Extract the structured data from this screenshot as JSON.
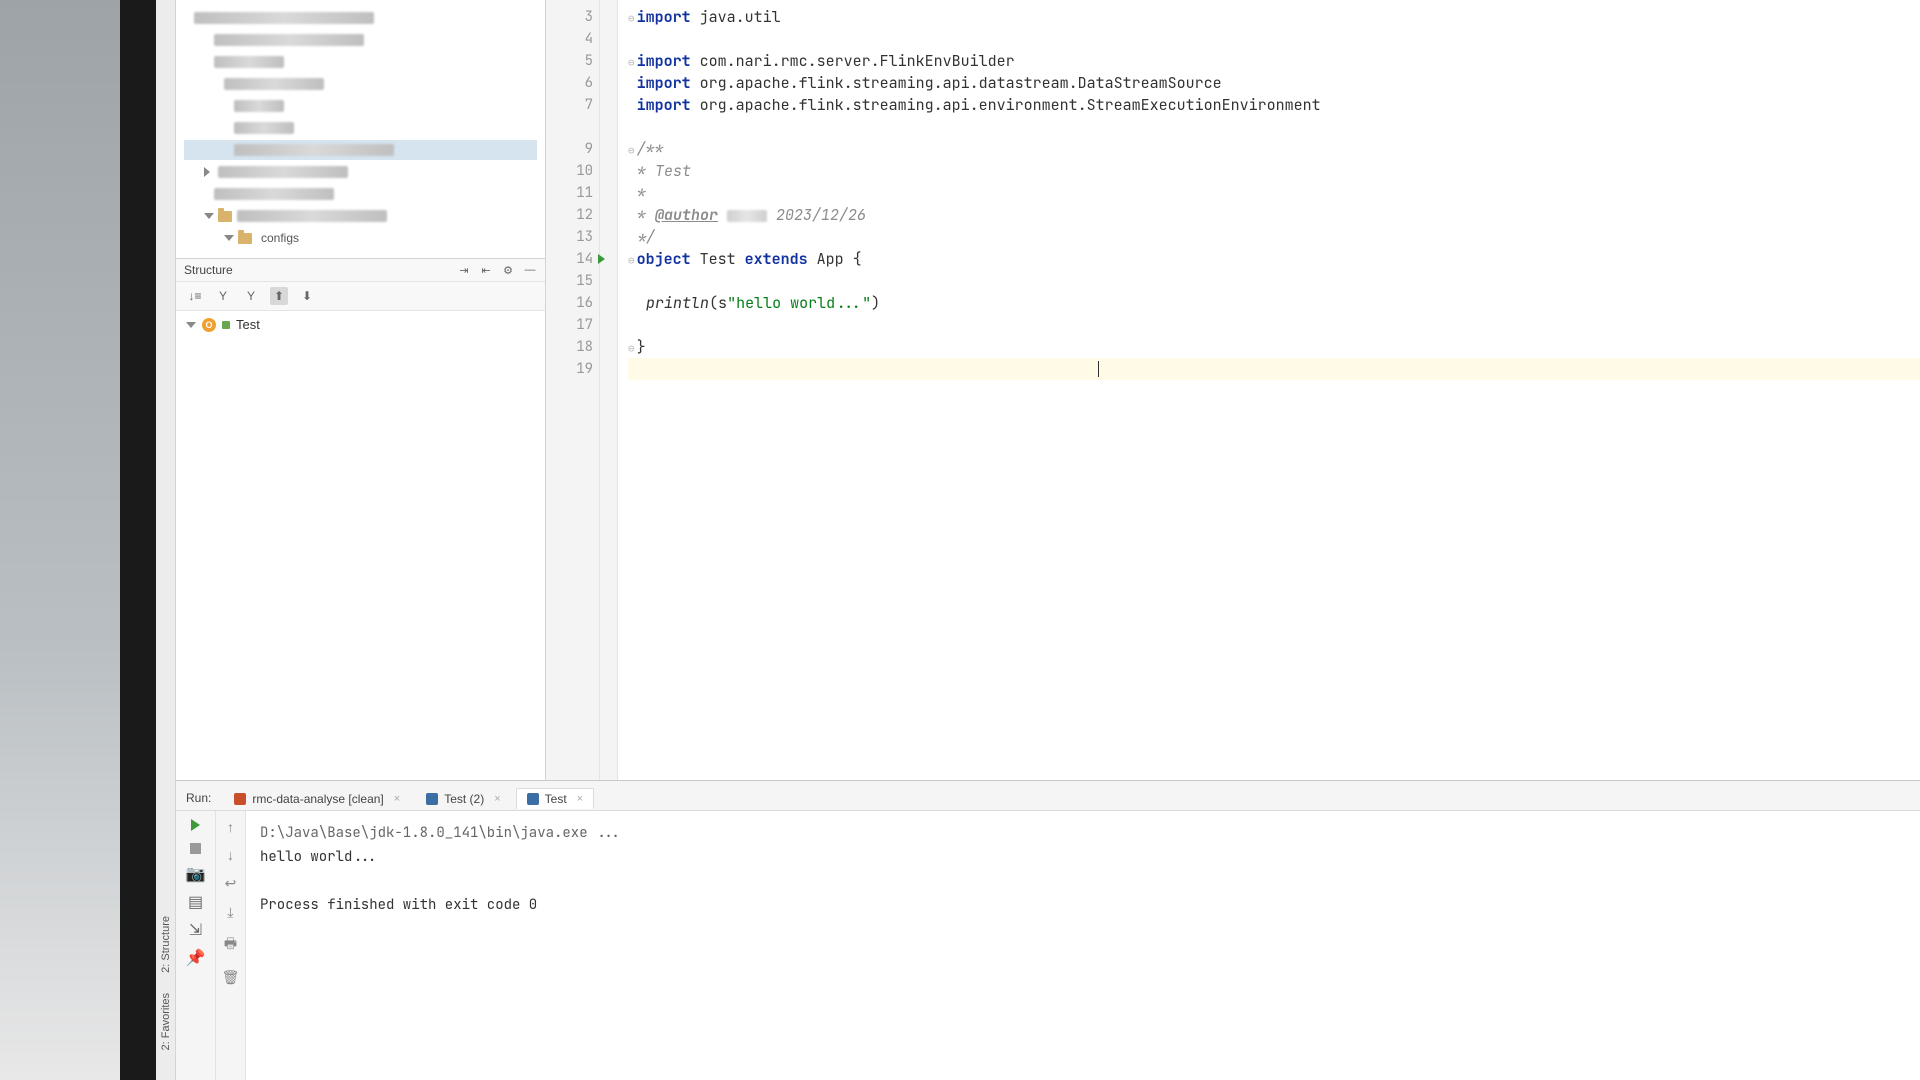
{
  "project_tree": {
    "configs_label": "configs"
  },
  "structure": {
    "title": "Structure",
    "root": "Test"
  },
  "editor": {
    "lines": {
      "l3_kw": "import",
      "l3_rest": " java.util",
      "l5_kw": "import",
      "l5_rest": " com.nari.rmc.server.FlinkEnvBuilder",
      "l6_kw": "import",
      "l6_rest": " org.apache.flink.streaming.api.datastream.DataStreamSource",
      "l7_kw": "import",
      "l7_rest": " org.apache.flink.streaming.api.environment.StreamExecutionEnvironment",
      "l9": "/**",
      "l10": " * Test",
      "l11": " *",
      "l12_pre": " * ",
      "l12_tag": "@author",
      "l12_post": " ",
      "l12_date": " 2023/12/26",
      "l13": " */",
      "l14_kw1": "object",
      "l14_name": " Test ",
      "l14_kw2": "extends",
      "l14_rest": " App {",
      "l16_pre": "  ",
      "l16_fn": "println",
      "l16_open": "(",
      "l16_s": "s",
      "l16_str": "\"hello world...\"",
      "l16_close": ")",
      "l18": "}"
    },
    "line_numbers": [
      "3",
      "4",
      "5",
      "6",
      "7",
      "",
      "9",
      "10",
      "11",
      "12",
      "13",
      "14",
      "15",
      "16",
      "17",
      "18",
      "19"
    ]
  },
  "run": {
    "label": "Run:",
    "tabs": [
      {
        "label": "rmc-data-analyse [clean]"
      },
      {
        "label": "Test (2)"
      },
      {
        "label": "Test"
      }
    ],
    "console": {
      "cmd": "D:\\Java\\Base\\jdk-1.8.0_141\\bin\\java.exe ...",
      "out": "hello world...",
      "exit": "Process finished with exit code 0"
    }
  },
  "left_rail": {
    "structure": "2: Structure",
    "favorites": "2: Favorites"
  }
}
